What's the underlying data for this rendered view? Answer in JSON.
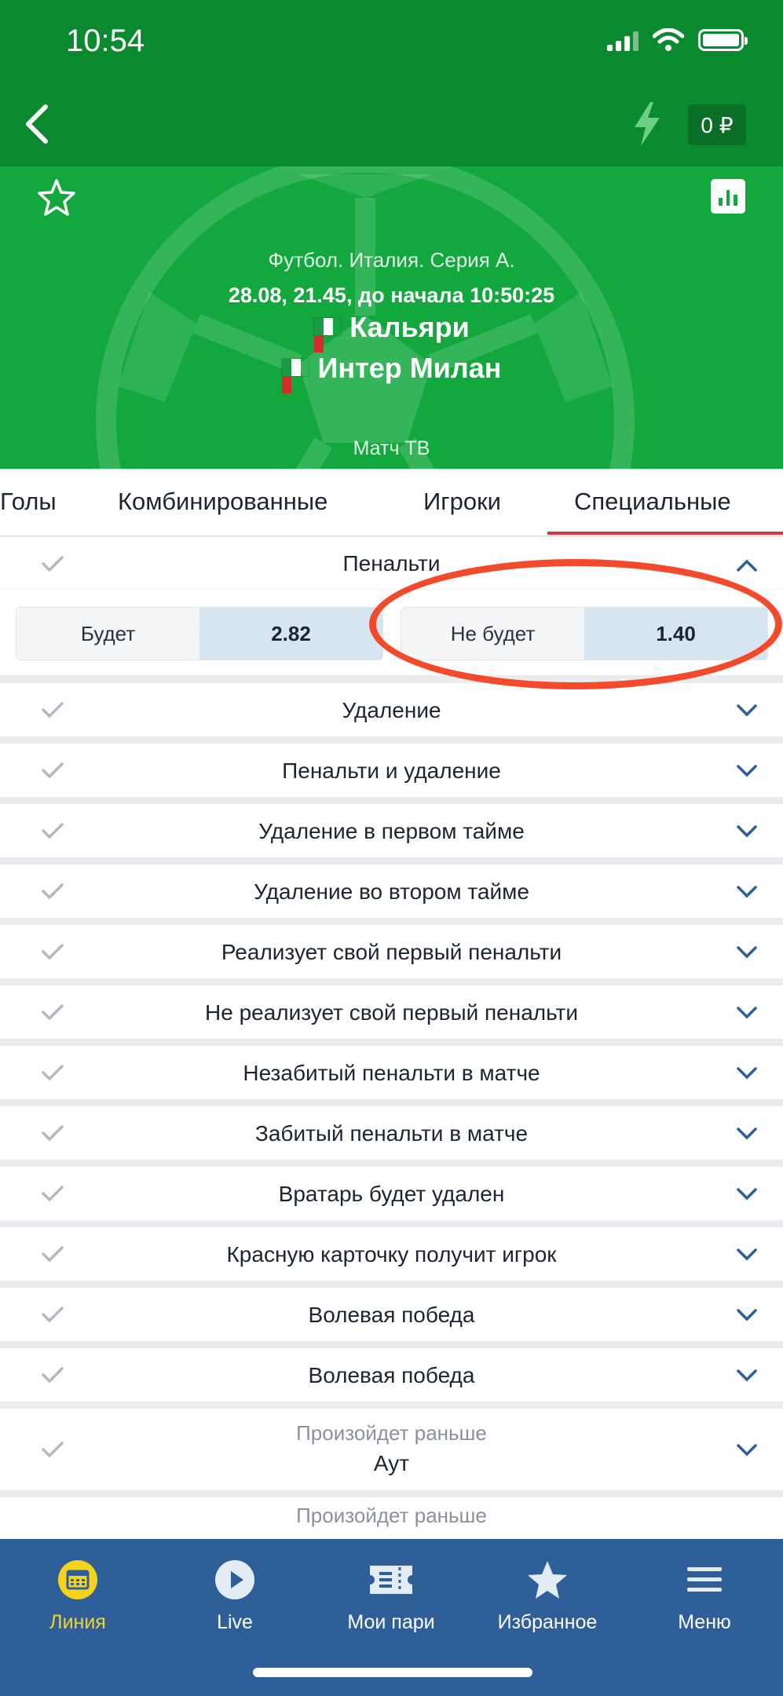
{
  "status": {
    "time": "10:54"
  },
  "nav": {
    "balance": "0 ₽"
  },
  "event": {
    "league": "Футбол. Италия. Серия А.",
    "datetime": "28.08, 21.45,  до начала 10:50:25",
    "team1": "Кальяри",
    "team2": "Интер Милан",
    "broadcast": "Матч ТВ"
  },
  "tabs": [
    "Голы",
    "Комбинированные",
    "Игроки",
    "Специальные"
  ],
  "active_tab": "Специальные",
  "penalty_market": {
    "title": "Пенальти",
    "options": [
      {
        "label": "Будет",
        "odds": "2.82"
      },
      {
        "label": "Не будет",
        "odds": "1.40"
      }
    ]
  },
  "markets": [
    "Удаление",
    "Пенальти и удаление",
    "Удаление в первом тайме",
    "Удаление во втором тайме",
    "Реализует свой первый пенальти",
    "Не реализует свой первый пенальти",
    "Незабитый пенальти в матче",
    "Забитый пенальти в матче",
    "Вратарь будет удален",
    "Красную карточку получит игрок",
    "Волевая победа",
    "Волевая победа"
  ],
  "market_occurs_first": {
    "subtitle": "Произойдет раньше",
    "title": "Аут"
  },
  "market_partial": {
    "subtitle": "Произойдет раньше"
  },
  "bottom_nav": [
    {
      "label": "Линия",
      "icon": "calendar-icon",
      "active": true
    },
    {
      "label": "Live",
      "icon": "play-icon",
      "active": false
    },
    {
      "label": "Мои пари",
      "icon": "ticket-icon",
      "active": false
    },
    {
      "label": "Избранное",
      "icon": "star-icon",
      "active": false
    },
    {
      "label": "Меню",
      "icon": "menu-icon",
      "active": false
    }
  ],
  "colors": {
    "header_green": "#0a8a2f",
    "event_green": "#12a83d",
    "nav_blue": "#2e5f99",
    "active_yellow": "#f6d31c",
    "tab_underline": "#d6363c",
    "highlight_red": "#f24a2a",
    "odds_bg": "#d6e5ef"
  }
}
